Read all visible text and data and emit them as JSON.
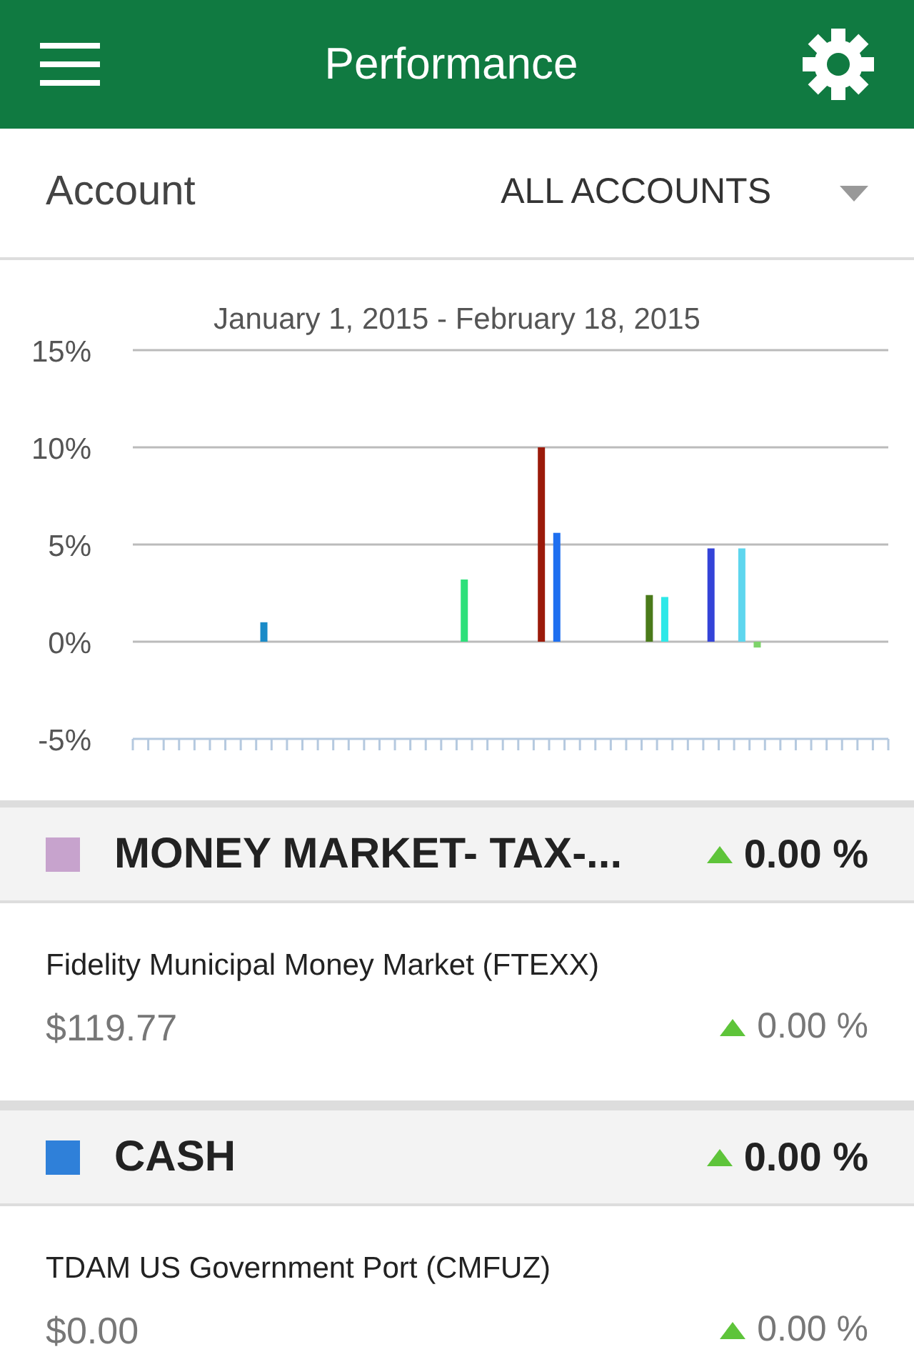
{
  "header": {
    "title": "Performance"
  },
  "account": {
    "label": "Account",
    "value": "ALL ACCOUNTS"
  },
  "chart_data": {
    "type": "bar",
    "title": "January 1, 2015 - February 18, 2015",
    "ylim": [
      -5,
      15
    ],
    "grid": true,
    "yticks": [
      {
        "value": 15,
        "label": "15%"
      },
      {
        "value": 10,
        "label": "10%"
      },
      {
        "value": 5,
        "label": "5%"
      },
      {
        "value": 0,
        "label": "0%"
      },
      {
        "value": -5,
        "label": "-5%"
      }
    ],
    "categories": [
      null,
      null,
      null,
      null,
      null,
      null,
      null,
      null,
      null,
      null,
      null,
      null,
      null,
      null,
      null,
      null,
      null,
      null,
      null,
      null,
      null,
      null,
      null,
      null,
      null,
      null,
      null,
      null,
      null,
      null,
      null,
      null,
      null,
      null,
      null,
      null,
      null,
      null,
      null,
      null,
      null,
      null,
      null,
      null,
      null,
      null,
      null,
      null,
      null
    ],
    "series": [
      {
        "values": [
          null,
          null,
          null,
          null,
          null,
          null,
          null,
          null,
          1.0,
          null,
          null,
          null,
          null,
          null,
          null,
          null,
          null,
          null,
          null,
          null,
          null,
          3.2,
          null,
          null,
          null,
          null,
          10.0,
          5.6,
          null,
          null,
          null,
          null,
          null,
          2.4,
          2.3,
          null,
          null,
          4.8,
          null,
          4.8,
          -0.3,
          null,
          null,
          null,
          null,
          null,
          null,
          null,
          null
        ],
        "colors": [
          null,
          null,
          null,
          null,
          null,
          null,
          null,
          null,
          "#1a8bc8",
          null,
          null,
          null,
          null,
          null,
          null,
          null,
          null,
          null,
          null,
          null,
          null,
          "#2ee07a",
          null,
          null,
          null,
          null,
          "#9b1a0a",
          "#1e6ff0",
          null,
          null,
          null,
          null,
          null,
          "#4a7a1a",
          "#2ee8e8",
          null,
          null,
          "#3443d8",
          null,
          "#5ed6ee",
          "#7ed36a",
          null,
          null,
          null,
          null,
          null,
          null,
          null,
          null
        ]
      }
    ]
  },
  "groups": [
    {
      "title": "MONEY MARKET- TAX-...",
      "color": "#c7a3cd",
      "rising": true,
      "change": "0.00 %",
      "holdings": [
        {
          "name": "Fidelity Municipal Money Market (FTEXX)",
          "value": "$119.77",
          "rising": true,
          "change": "0.00 %"
        }
      ]
    },
    {
      "title": "CASH",
      "color": "#2f80d9",
      "rising": true,
      "change": "0.00 %",
      "holdings": [
        {
          "name": "TDAM US Government Port (CMFUZ)",
          "value": "$0.00",
          "rising": true,
          "change": "0.00 %"
        }
      ]
    }
  ]
}
